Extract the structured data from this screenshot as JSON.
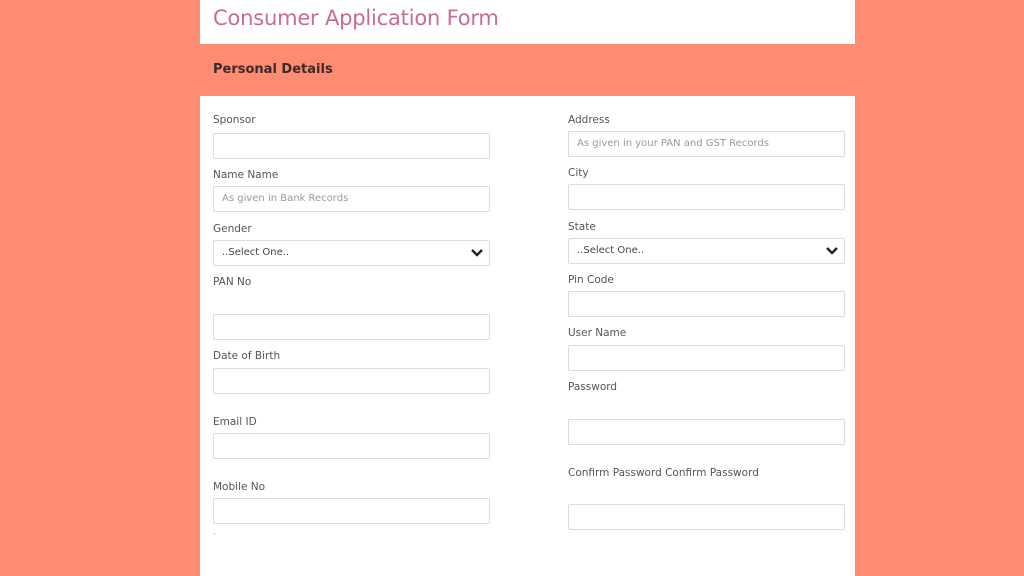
{
  "header": {
    "title": "Consumer Application Form"
  },
  "section": {
    "title": "Personal Details"
  },
  "left_fields": {
    "sponsor": {
      "label": "Sponsor",
      "value": "",
      "placeholder": ""
    },
    "name": {
      "label": "Name Name",
      "value": "",
      "placeholder": "As given in Bank Records"
    },
    "gender": {
      "label": "Gender",
      "selected": "..Select One.."
    },
    "pan": {
      "label": "PAN No",
      "value": "",
      "placeholder": ""
    },
    "dob": {
      "label": "Date of Birth",
      "value": "",
      "placeholder": ""
    },
    "email": {
      "label": "Email ID",
      "value": "",
      "placeholder": ""
    },
    "mobile": {
      "label": "Mobile No",
      "value": "",
      "placeholder": ""
    },
    "footnote": "`"
  },
  "right_fields": {
    "address": {
      "label": "Address",
      "value": "",
      "placeholder": "As given in your PAN and GST Records"
    },
    "city": {
      "label": "City",
      "value": "",
      "placeholder": ""
    },
    "state": {
      "label": "State",
      "selected": "..Select One.."
    },
    "pincode": {
      "label": "Pin Code",
      "value": "",
      "placeholder": ""
    },
    "username": {
      "label": "User Name",
      "value": "",
      "placeholder": ""
    },
    "password": {
      "label": "Password",
      "value": "",
      "placeholder": ""
    },
    "confirm_password": {
      "label": "Confirm Password Confirm Password",
      "value": "",
      "placeholder": ""
    }
  },
  "colors": {
    "background": "#fe8c72",
    "title": "#c96b98",
    "section_text": "#3a2a28"
  }
}
